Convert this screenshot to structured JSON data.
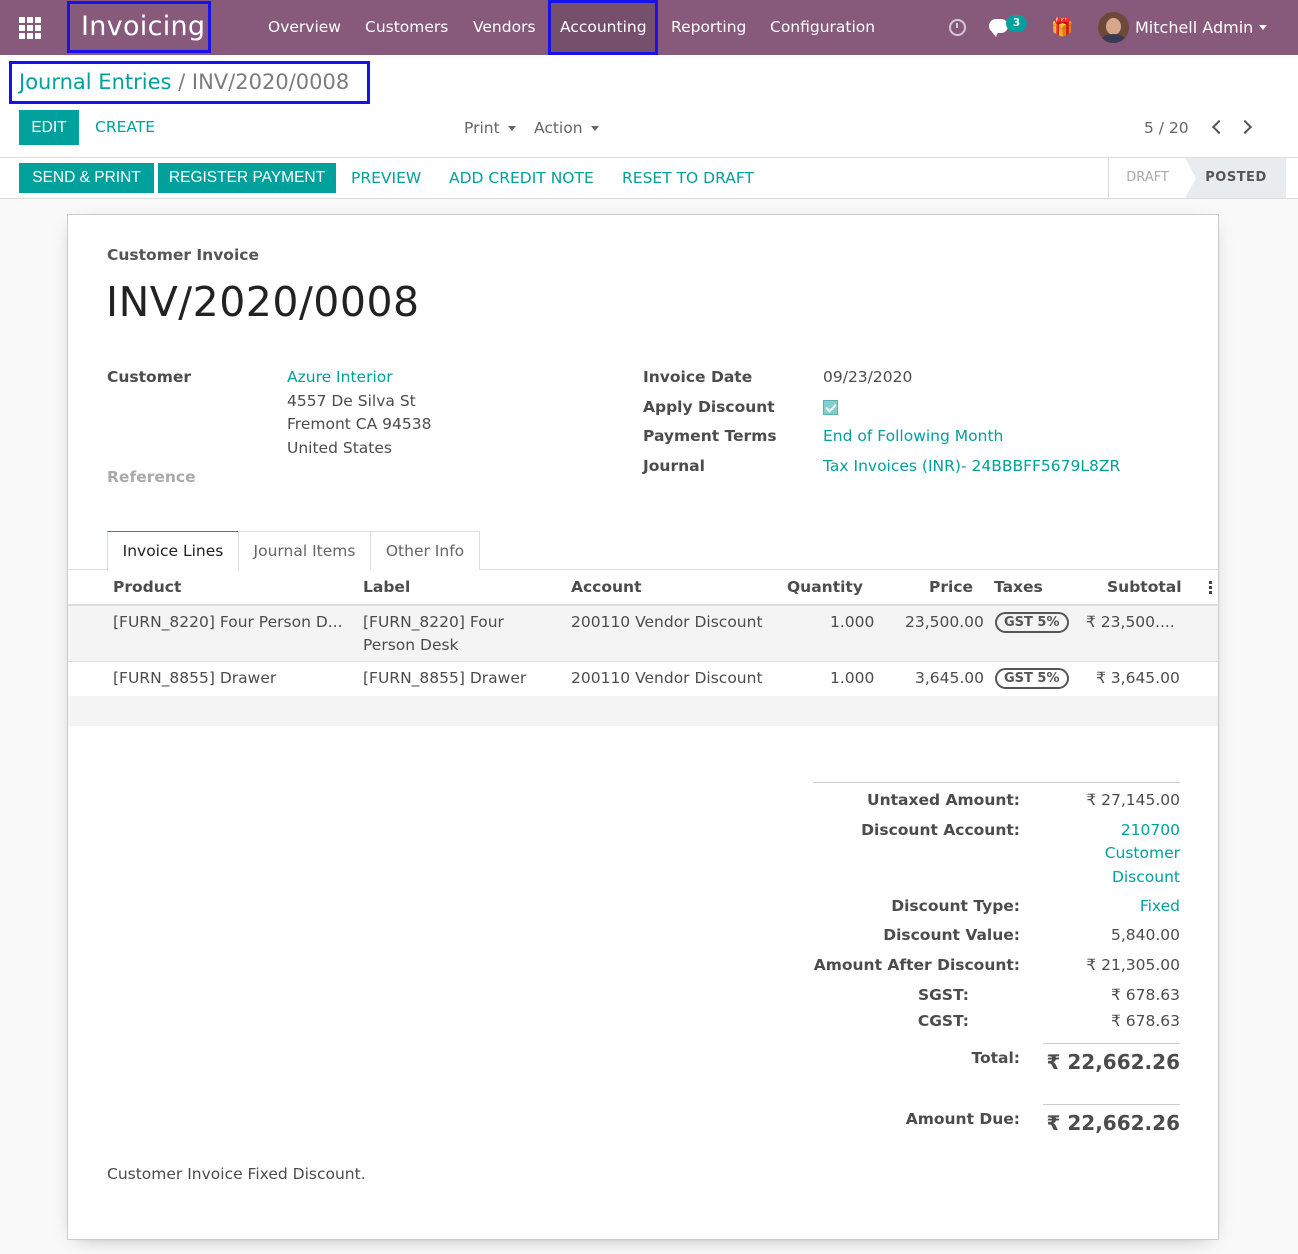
{
  "navbar": {
    "app_name": "Invoicing",
    "menu": [
      "Overview",
      "Customers",
      "Vendors",
      "Accounting",
      "Reporting",
      "Configuration"
    ],
    "chat_count": "3",
    "user_name": "Mitchell Admin"
  },
  "breadcrumb": {
    "parent": "Journal Entries",
    "separator": "/",
    "current": "INV/2020/0008"
  },
  "control_panel": {
    "edit_label": "EDIT",
    "create_label": "CREATE",
    "print_label": "Print",
    "action_label": "Action",
    "pager": "5 / 20"
  },
  "statusbar": {
    "buttons": [
      "SEND & PRINT",
      "REGISTER PAYMENT",
      "PREVIEW",
      "ADD CREDIT NOTE",
      "RESET TO DRAFT"
    ],
    "states": [
      "DRAFT",
      "POSTED"
    ],
    "active_state": "POSTED"
  },
  "invoice": {
    "type": "Customer Invoice",
    "number": "INV/2020/0008",
    "customer_label": "Customer",
    "customer_name": "Azure Interior",
    "address": [
      "4557 De Silva St",
      "Fremont CA 94538",
      "United States"
    ],
    "reference_label": "Reference",
    "invoice_date_label": "Invoice Date",
    "invoice_date": "09/23/2020",
    "apply_discount_label": "Apply Discount",
    "apply_discount": true,
    "payment_terms_label": "Payment Terms",
    "payment_terms": "End of Following Month",
    "journal_label": "Journal",
    "journal": "Tax Invoices (INR)- 24BBBFF5679L8ZR"
  },
  "tabs": [
    "Invoice Lines",
    "Journal Items",
    "Other Info"
  ],
  "table": {
    "columns": [
      "Product",
      "Label",
      "Account",
      "Quantity",
      "Price",
      "Taxes",
      "Subtotal"
    ],
    "rows": [
      {
        "product": "[FURN_8220] Four Person D...",
        "label": "[FURN_8220] Four Person Desk",
        "account": "200110 Vendor Discount",
        "quantity": "1.000",
        "price": "23,500.00",
        "tax": "GST 5%",
        "subtotal": "₹ 23,500...."
      },
      {
        "product": "[FURN_8855] Drawer",
        "label": "[FURN_8855] Drawer",
        "account": "200110 Vendor Discount",
        "quantity": "1.000",
        "price": "3,645.00",
        "tax": "GST 5%",
        "subtotal": "₹ 3,645.00"
      }
    ]
  },
  "totals": {
    "untaxed_label": "Untaxed Amount:",
    "untaxed": "₹ 27,145.00",
    "discount_account_label": "Discount Account:",
    "discount_account": [
      "210700",
      "Customer",
      "Discount"
    ],
    "discount_type_label": "Discount Type:",
    "discount_type": "Fixed",
    "discount_value_label": "Discount Value:",
    "discount_value": "5,840.00",
    "after_discount_label": "Amount After Discount:",
    "after_discount": "₹ 21,305.00",
    "sgst_label": "SGST:",
    "sgst": "₹ 678.63",
    "cgst_label": "CGST:",
    "cgst": "₹ 678.63",
    "total_label": "Total:",
    "total": "₹ 22,662.26",
    "amount_due_label": "Amount Due:",
    "amount_due": "₹ 22,662.26"
  },
  "narration": "Customer Invoice Fixed Discount.",
  "colors": {
    "navbar": "#875a7b",
    "accent": "#00a09d",
    "highlight_border": "#1a10e8"
  }
}
